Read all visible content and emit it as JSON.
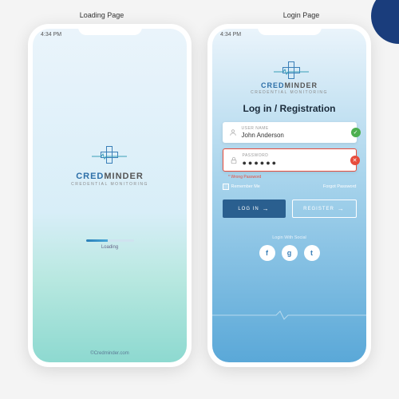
{
  "page_labels": {
    "loading": "Loading Page",
    "login": "Login Page"
  },
  "status_time": "4:34 PM",
  "brand": {
    "part1": "CRED",
    "part2": "MINDER",
    "tagline": "CREDENTIAL MONITORING"
  },
  "loading": {
    "label": "Loading",
    "footer": "©Credminder.com",
    "progress_pct": 45
  },
  "login": {
    "title": "Log in / Registration",
    "username": {
      "label": "USER NAME",
      "value": "John Anderson",
      "valid": true
    },
    "password": {
      "label": "PASSWORD",
      "value": "●●●●●●",
      "valid": false
    },
    "error_msg": "* Wrong Password",
    "remember": "Remember Me",
    "forgot": "Forgot Password",
    "login_btn": "LOG IN",
    "register_btn": "REGISTER",
    "social_label": "Login With Social",
    "socials": {
      "fb": "f",
      "google": "g",
      "twitter": "t"
    }
  },
  "colors": {
    "primary": "#2a6fa8",
    "error": "#e74c3c",
    "success": "#4caf50"
  }
}
